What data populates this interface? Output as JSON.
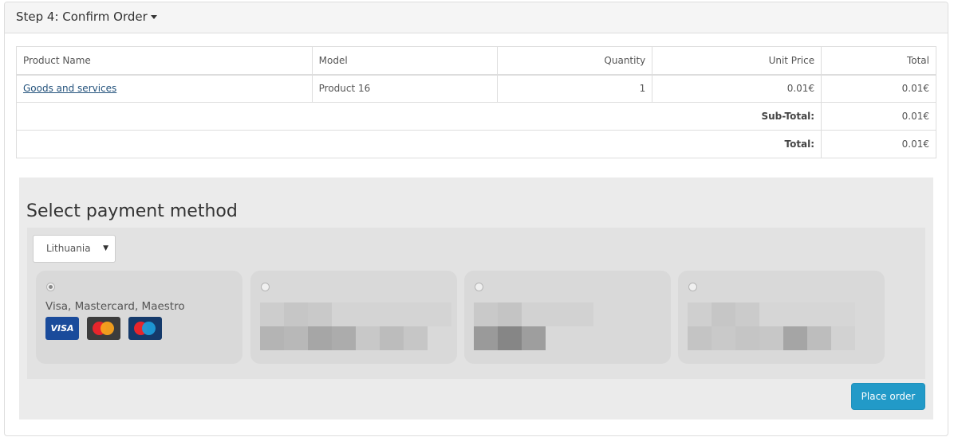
{
  "panel": {
    "heading": "Step 4: Confirm Order"
  },
  "cart": {
    "columns": [
      "Product Name",
      "Model",
      "Quantity",
      "Unit Price",
      "Total"
    ],
    "items": [
      {
        "name": "Goods and services",
        "model": "Product 16",
        "quantity": "1",
        "unit_price": "0.01€",
        "total": "0.01€"
      }
    ],
    "subtotal_label": "Sub-Total:",
    "subtotal_value": "0.01€",
    "total_label": "Total:",
    "total_value": "0.01€"
  },
  "payment": {
    "title": "Select payment method",
    "country": "Lithuania",
    "methods": [
      {
        "name": "Visa, Mastercard, Maestro",
        "selected": true,
        "cards": [
          "VISA",
          "mastercard-icon",
          "maestro-icon"
        ]
      },
      {
        "name": "",
        "selected": false
      },
      {
        "name": "",
        "selected": false
      },
      {
        "name": "",
        "selected": false
      }
    ],
    "submit_label": "Place order"
  },
  "colors": {
    "button": "#229ac8",
    "link": "#23527c",
    "panel_bg": "#ebebeb"
  }
}
